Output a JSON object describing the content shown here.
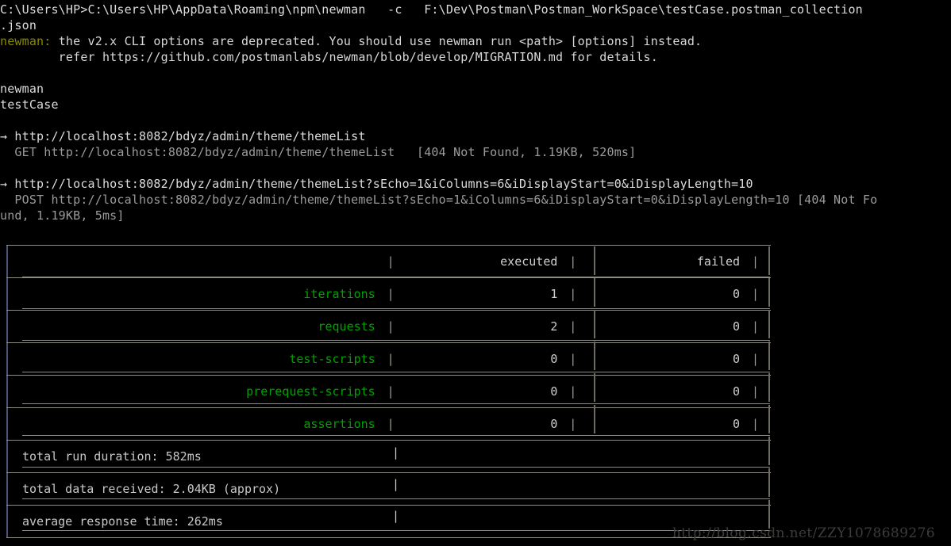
{
  "terminal": {
    "background": "#000000",
    "foreground": "#c8c8c8",
    "accent_green": "#00a000",
    "accent_olive": "#8a8a00",
    "border_color": "#8c8c84",
    "left_edge_color": "#4a5478"
  },
  "console": {
    "prompt": "C:\\Users\\HP>",
    "command": "C:\\Users\\HP\\AppData\\Roaming\\npm\\newman   -c   F:\\Dev\\Postman\\Postman_WorkSpace\\testCase.postman_collection",
    "command_wrap": ".json",
    "warning_label": "newman:",
    "warning_text": " the v2.x CLI options are deprecated. You should use newman run <path> [options] instead.",
    "warning_text2": "        refer https://github.com/postmanlabs/newman/blob/develop/MIGRATION.md for details.",
    "banner": "newman",
    "collection_name": "testCase",
    "requests": [
      {
        "arrow": "→",
        "name": " http://localhost:8082/bdyz/admin/theme/themeList",
        "detail": "  GET http://localhost:8082/bdyz/admin/theme/themeList   [404 Not Found, 1.19KB, 520ms]",
        "detail_wrap": ""
      },
      {
        "arrow": "→",
        "name": " http://localhost:8082/bdyz/admin/theme/themeList?sEcho=1&iColumns=6&iDisplayStart=0&iDisplayLength=10",
        "detail": "  POST http://localhost:8082/bdyz/admin/theme/themeList?sEcho=1&iColumns=6&iDisplayStart=0&iDisplayLength=10 [404 Not Fo",
        "detail_wrap": "und, 1.19KB, 5ms]"
      }
    ]
  },
  "summary": {
    "headers": [
      "",
      "executed",
      "failed"
    ],
    "pipe": "|",
    "rows": [
      {
        "label": "iterations",
        "executed": "1",
        "failed": "0"
      },
      {
        "label": "requests",
        "executed": "2",
        "failed": "0"
      },
      {
        "label": "test-scripts",
        "executed": "0",
        "failed": "0"
      },
      {
        "label": "prerequest-scripts",
        "executed": "0",
        "failed": "0"
      },
      {
        "label": "assertions",
        "executed": "0",
        "failed": "0"
      }
    ],
    "totals": [
      {
        "text": "total run duration: 582ms"
      },
      {
        "text": "total data received: 2.04KB (approx)"
      },
      {
        "text": "average response time: 262ms"
      }
    ]
  },
  "watermark": {
    "text": "http://blog.csdn.net/ZZY1078689276"
  }
}
